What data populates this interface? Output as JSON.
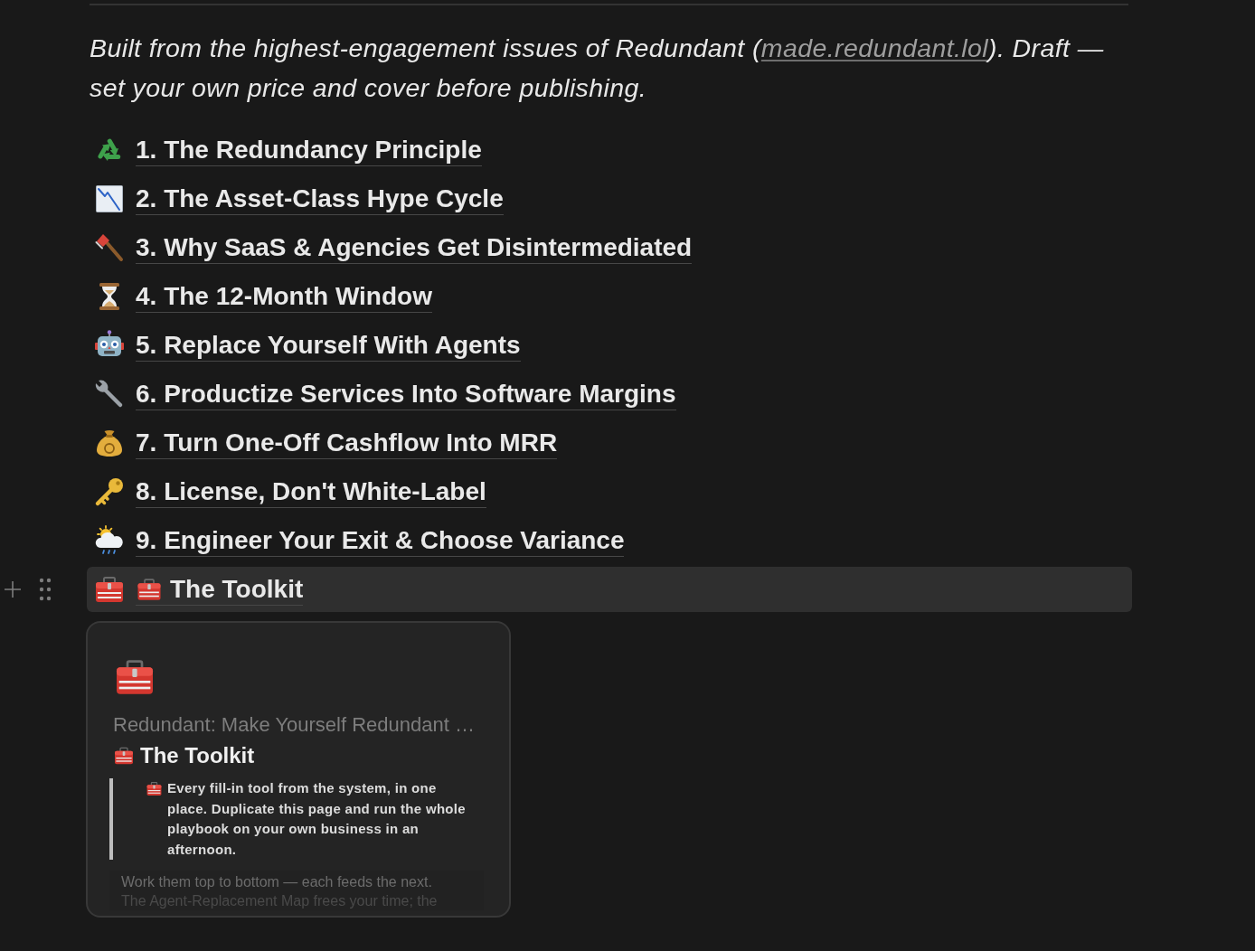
{
  "intro": {
    "text_before": "Built from the highest-engagement issues of Redundant (",
    "link": "made.redundant.lol",
    "text_after": "). Draft — set your own price and cover before publishing."
  },
  "pages": [
    {
      "kind": "recycle",
      "title": "1. The Redundancy Principle",
      "title_icon": false,
      "hovered": false
    },
    {
      "kind": "chart",
      "title": "2. The Asset-Class Hype Cycle",
      "title_icon": false,
      "hovered": false
    },
    {
      "kind": "axe",
      "title": "3. Why SaaS & Agencies Get Disintermediated",
      "title_icon": false,
      "hovered": false
    },
    {
      "kind": "hourglass",
      "title": "4. The 12-Month Window",
      "title_icon": false,
      "hovered": false
    },
    {
      "kind": "robot",
      "title": "5. Replace Yourself With Agents",
      "title_icon": false,
      "hovered": false
    },
    {
      "kind": "wrench",
      "title": "6. Productize Services Into Software Margins",
      "title_icon": false,
      "hovered": false
    },
    {
      "kind": "moneybag",
      "title": "7. Turn One-Off Cashflow Into MRR",
      "title_icon": false,
      "hovered": false
    },
    {
      "kind": "key",
      "title": "8. License, Don't White-Label",
      "title_icon": false,
      "hovered": false
    },
    {
      "kind": "raincloud",
      "title": "9. Engineer Your Exit & Choose Variance",
      "title_icon": false,
      "hovered": false
    },
    {
      "kind": "toolbox",
      "title": "The Toolkit",
      "title_icon": true,
      "hovered": true
    }
  ],
  "preview_card": {
    "kind": "toolbox",
    "breadcrumb": "Redundant: Make Yourself Redundant …",
    "title": "The Toolkit",
    "callout": {
      "kind": "toolbox",
      "text": "Every fill-in tool from the system, in one place. Duplicate this page and run the whole playbook on your own business in an afternoon."
    },
    "body": [
      "Work them top to bottom — each feeds the next.",
      "The Agent-Replacement Map frees your time; the"
    ]
  }
}
